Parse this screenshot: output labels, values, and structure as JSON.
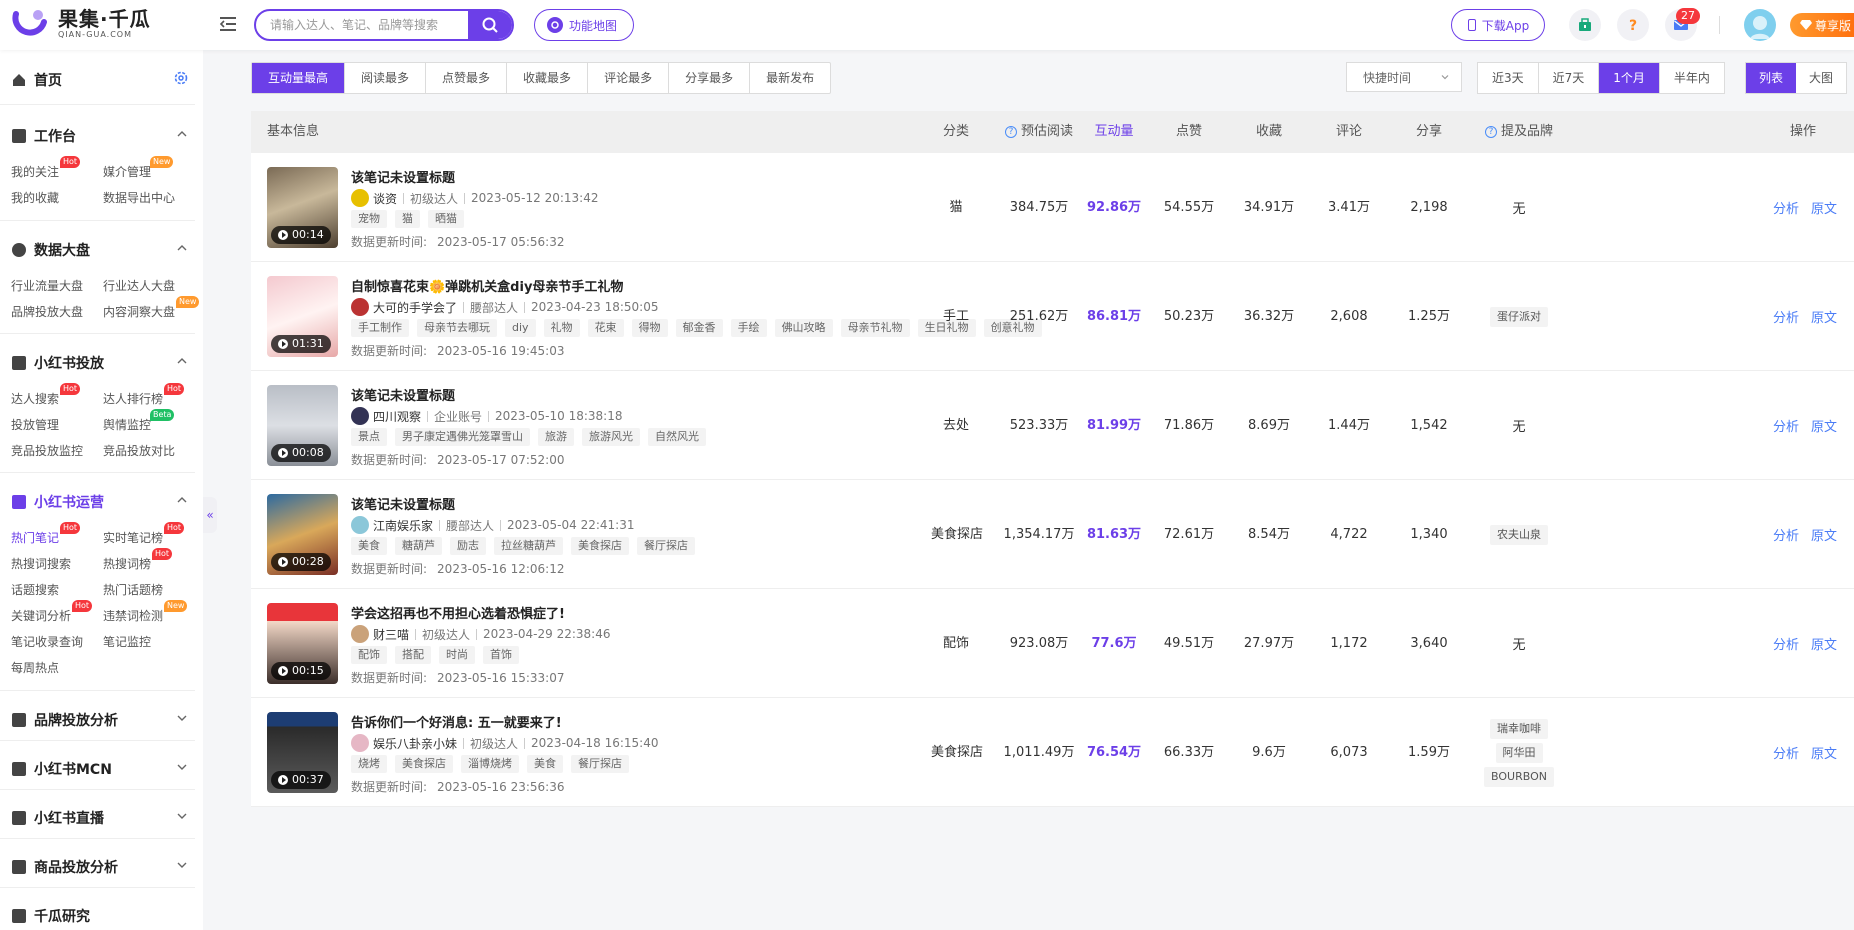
{
  "brand": {
    "name_cn": "果集·千瓜",
    "name_en": "QIAN-GUA.COM"
  },
  "header": {
    "search_placeholder": "请输入达人、笔记、品牌等搜索",
    "func_map": "功能地图",
    "download_app": "下载App",
    "mail_count": "27",
    "vip_label": "尊享版"
  },
  "sidebar": {
    "home": "首页",
    "sections": [
      {
        "title": "工作台",
        "items": [
          {
            "label": "我的关注",
            "tag": "Hot"
          },
          {
            "label": "媒介管理",
            "tag": "New"
          },
          {
            "label": "我的收藏"
          },
          {
            "label": "数据导出中心"
          }
        ]
      },
      {
        "title": "数据大盘",
        "items": [
          {
            "label": "行业流量大盘"
          },
          {
            "label": "行业达人大盘"
          },
          {
            "label": "品牌投放大盘"
          },
          {
            "label": "内容洞察大盘",
            "tag": "New"
          }
        ]
      },
      {
        "title": "小红书投放",
        "items": [
          {
            "label": "达人搜索",
            "tag": "Hot"
          },
          {
            "label": "达人排行榜",
            "tag": "Hot"
          },
          {
            "label": "投放管理"
          },
          {
            "label": "舆情监控",
            "tag": "Beta"
          },
          {
            "label": "竞品投放监控"
          },
          {
            "label": "竞品投放对比"
          }
        ]
      },
      {
        "title": "小红书运营",
        "items": [
          {
            "label": "热门笔记",
            "tag": "Hot"
          },
          {
            "label": "实时笔记榜",
            "tag": "Hot"
          },
          {
            "label": "热搜词搜索"
          },
          {
            "label": "热搜词榜",
            "tag": "Hot"
          },
          {
            "label": "话题搜索"
          },
          {
            "label": "热门话题榜"
          },
          {
            "label": "关键词分析",
            "tag": "Hot"
          },
          {
            "label": "违禁词检测",
            "tag": "New"
          },
          {
            "label": "笔记收录查询"
          },
          {
            "label": "笔记监控"
          },
          {
            "label": "每周热点"
          }
        ]
      },
      {
        "title": "品牌投放分析"
      },
      {
        "title": "小红书MCN"
      },
      {
        "title": "小红书直播"
      },
      {
        "title": "商品投放分析"
      },
      {
        "title": "千瓜研究"
      }
    ]
  },
  "filters": {
    "sort_tabs": [
      "互动量最高",
      "阅读最多",
      "点赞最多",
      "收藏最多",
      "评论最多",
      "分享最多",
      "最新发布"
    ],
    "time_select": "快捷时间",
    "periods": [
      "近3天",
      "近7天",
      "1个月",
      "半年内"
    ],
    "views": [
      "列表",
      "大图"
    ]
  },
  "table": {
    "columns": [
      "基本信息",
      "分类",
      "预估阅读",
      "互动量",
      "点赞",
      "收藏",
      "评论",
      "分享",
      "提及品牌",
      "操作"
    ],
    "update_label": "数据更新时间:",
    "op_analyze": "分析",
    "op_source": "原文",
    "rows": [
      {
        "title": "该笔记未设置标题",
        "author": "谈资",
        "level": "初级达人",
        "date": "2023-05-12 20:13:42",
        "tags": [
          "宠物",
          "猫",
          "晒猫"
        ],
        "updated": "2023-05-17 05:56:32",
        "duration": "00:14",
        "category": "猫",
        "reads": "384.75万",
        "interactions": "92.86万",
        "likes": "54.55万",
        "favorites": "34.91万",
        "comments": "3.41万",
        "shares": "2,198",
        "brands": [
          "无"
        ]
      },
      {
        "title": "自制惊喜花束🌼弹跳机关盒diy母亲节手工礼物",
        "author": "大可的手学会了",
        "level": "腰部达人",
        "date": "2023-04-23 18:50:05",
        "tags": [
          "手工制作",
          "母亲节去哪玩",
          "diy",
          "礼物",
          "花束",
          "得物",
          "郁金香",
          "手绘",
          "佛山攻略",
          "母亲节礼物",
          "生日礼物",
          "创意礼物"
        ],
        "updated": "2023-05-16 19:45:03",
        "duration": "01:31",
        "category": "手工",
        "reads": "251.62万",
        "interactions": "86.81万",
        "likes": "50.23万",
        "favorites": "36.32万",
        "comments": "2,608",
        "shares": "1.25万",
        "brands": [
          "蛋仔派对"
        ]
      },
      {
        "title": "该笔记未设置标题",
        "author": "四川观察",
        "level": "企业账号",
        "date": "2023-05-10 18:38:18",
        "tags": [
          "景点",
          "男子康定遇佛光笼罩雪山",
          "旅游",
          "旅游风光",
          "自然风光"
        ],
        "updated": "2023-05-17 07:52:00",
        "duration": "00:08",
        "category": "去处",
        "reads": "523.33万",
        "interactions": "81.99万",
        "likes": "71.86万",
        "favorites": "8.69万",
        "comments": "1.44万",
        "shares": "1,542",
        "brands": [
          "无"
        ]
      },
      {
        "title": "该笔记未设置标题",
        "author": "江南娱乐家",
        "level": "腰部达人",
        "date": "2023-05-04 22:41:31",
        "tags": [
          "美食",
          "糖葫芦",
          "励志",
          "拉丝糖葫芦",
          "美食探店",
          "餐厅探店"
        ],
        "updated": "2023-05-16 12:06:12",
        "duration": "00:28",
        "category": "美食探店",
        "reads": "1,354.17万",
        "interactions": "81.63万",
        "likes": "72.61万",
        "favorites": "8.54万",
        "comments": "4,722",
        "shares": "1,340",
        "brands": [
          "农夫山泉"
        ]
      },
      {
        "title": "学会这招再也不用担心选着恐惧症了!",
        "author": "财三喵",
        "level": "初级达人",
        "date": "2023-04-29 22:38:46",
        "tags": [
          "配饰",
          "搭配",
          "时尚",
          "首饰"
        ],
        "updated": "2023-05-16 15:33:07",
        "duration": "00:15",
        "category": "配饰",
        "reads": "923.08万",
        "interactions": "77.6万",
        "likes": "49.51万",
        "favorites": "27.97万",
        "comments": "1,172",
        "shares": "3,640",
        "brands": [
          "无"
        ]
      },
      {
        "title": "告诉你们一个好消息: 五一就要来了!",
        "author": "娱乐八卦亲小妹",
        "level": "初级达人",
        "date": "2023-04-18 16:15:40",
        "tags": [
          "烧烤",
          "美食探店",
          "淄博烧烤",
          "美食",
          "餐厅探店"
        ],
        "updated": "2023-05-16 23:56:36",
        "duration": "00:37",
        "category": "美食探店",
        "reads": "1,011.49万",
        "interactions": "76.54万",
        "likes": "66.33万",
        "favorites": "9.6万",
        "comments": "6,073",
        "shares": "1.59万",
        "brands": [
          "瑞幸咖啡",
          "阿华田",
          "BOURBON"
        ]
      }
    ]
  },
  "colors": {
    "accent": "#6c3fe8",
    "link": "#4a7cf6",
    "hot": "#f5373c",
    "new": "#ff9a2e",
    "beta": "#20c065"
  }
}
